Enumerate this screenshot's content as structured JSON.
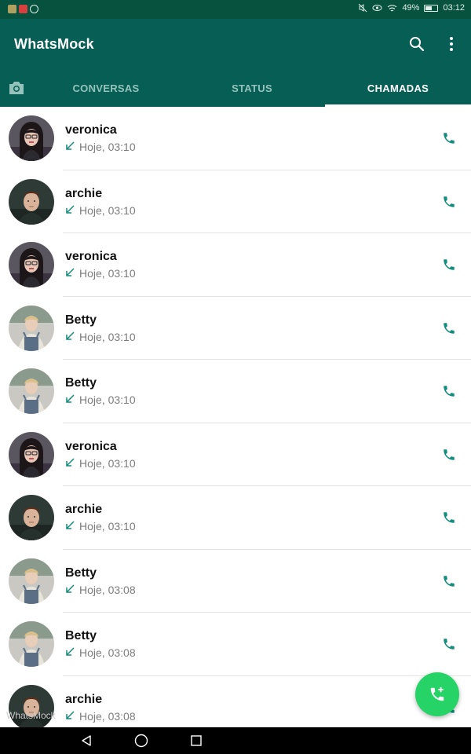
{
  "status_bar": {
    "battery": "49%",
    "time": "03:12",
    "notification_colors": [
      "#b0a060",
      "#d84040",
      "#dfeee9"
    ]
  },
  "app_bar": {
    "title": "WhatsMock",
    "search_icon": "search-icon",
    "menu_icon": "more-vert-icon"
  },
  "tabs": {
    "camera_icon": "camera-icon",
    "items": [
      {
        "label": "CONVERSAS",
        "active": false
      },
      {
        "label": "STATUS",
        "active": false
      },
      {
        "label": "CHAMADAS",
        "active": true
      }
    ]
  },
  "calls": [
    {
      "name": "veronica",
      "time": "Hoje, 03:10",
      "avatar": "veronica"
    },
    {
      "name": "archie",
      "time": "Hoje, 03:10",
      "avatar": "archie"
    },
    {
      "name": "veronica",
      "time": "Hoje, 03:10",
      "avatar": "veronica"
    },
    {
      "name": "Betty",
      "time": "Hoje, 03:10",
      "avatar": "betty"
    },
    {
      "name": "Betty",
      "time": "Hoje, 03:10",
      "avatar": "betty"
    },
    {
      "name": "veronica",
      "time": "Hoje, 03:10",
      "avatar": "veronica"
    },
    {
      "name": "archie",
      "time": "Hoje, 03:10",
      "avatar": "archie"
    },
    {
      "name": "Betty",
      "time": "Hoje, 03:08",
      "avatar": "betty"
    },
    {
      "name": "Betty",
      "time": "Hoje, 03:08",
      "avatar": "betty"
    },
    {
      "name": "archie",
      "time": "Hoje, 03:08",
      "avatar": "archie"
    }
  ],
  "watermark": "WhatsMock",
  "fab": {
    "icon": "add-call-icon"
  },
  "colors": {
    "primary": "#075e54",
    "status_bar": "#06523f",
    "accent": "#25d366",
    "call_icon": "#128c7e",
    "missed_arrow": "#128c7e"
  },
  "nav_bar": {
    "icons": [
      "back-icon",
      "home-icon",
      "recents-icon"
    ]
  }
}
